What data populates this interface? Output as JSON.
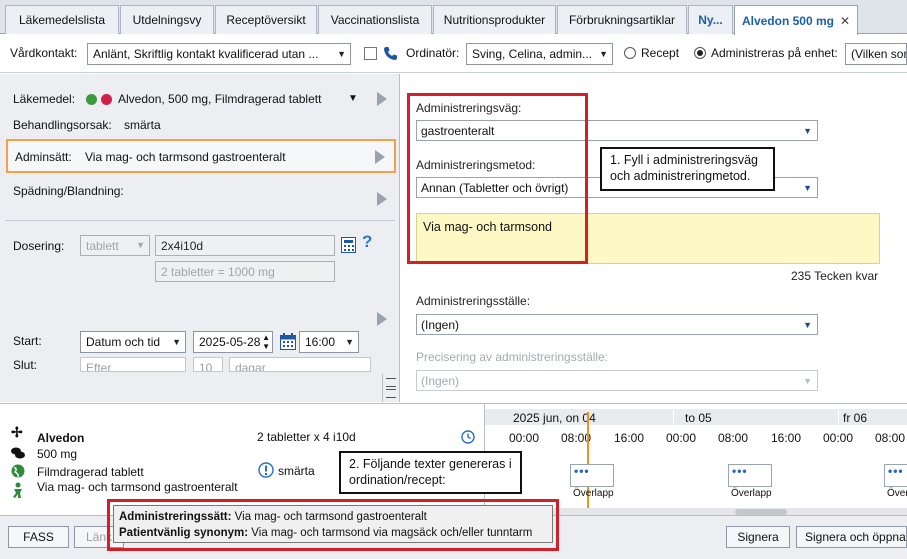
{
  "tabs": [
    {
      "label": "Läkemedelslista"
    },
    {
      "label": "Utdelningsvy"
    },
    {
      "label": "Receptöversikt"
    },
    {
      "label": "Vaccinationslista"
    },
    {
      "label": "Nutritionsprodukter"
    },
    {
      "label": "Förbrukningsartiklar"
    },
    {
      "label": "Ny..."
    },
    {
      "label": "Alvedon 500 mg",
      "close": "✕"
    }
  ],
  "toolbar": {
    "vardkontakt_label": "Vårdkontakt:",
    "vardkontakt_value": "Anlänt, Skriftlig kontakt kvalificerad utan ...",
    "ordinator_label": "Ordinatör:",
    "ordinator_value": "Sving, Celina, admin...",
    "recept_label": "Recept",
    "administreras_label": "Administreras på enhet:",
    "enhet_value": "(Vilken sor"
  },
  "left": {
    "lakemedel_label": "Läkemedel:",
    "lakemedel_value": "Alvedon, 500 mg, Filmdragerad tablett",
    "behandlingsorsak_label": "Behandlingsorsak:",
    "behandlingsorsak_value": "smärta",
    "admin_label": "Adminsätt:",
    "admin_value": "Via mag- och tarmsond gastroenteralt",
    "spadning_label": "Spädning/Blandning:",
    "dosering_label": "Dosering:",
    "dosering_unit": "tablett",
    "dosering_value": "2x4i10d",
    "dosering_calc": "2 tabletter = 1000 mg",
    "help": "?",
    "start_label": "Start:",
    "start_type": "Datum och tid",
    "start_date": "2025-05-28",
    "start_time": "16:00",
    "slut_label": "Slut:",
    "slut_type": "Efter",
    "slut_num": "10",
    "slut_unit": "dagar"
  },
  "right": {
    "vag_label": "Administreringsväg:",
    "vag_value": "gastroenteralt",
    "metod_label": "Administreringsmetod:",
    "metod_value": "Annan (Tabletter och övrigt)",
    "note_text": "Via mag- och tarmsond",
    "teckenkvar": "235 Tecken kvar",
    "stalle_label": "Administreringsställe:",
    "stalle_value": "(Ingen)",
    "precisering_label": "Precisering av administreringsställe:",
    "precisering_value": "(Ingen)"
  },
  "summary": {
    "name": "Alvedon",
    "strength": "500 mg",
    "form": "Filmdragerad tablett",
    "route": "Via mag- och tarmsond gastroenteralt",
    "dose": "2 tabletter x 4 i10d",
    "reason": "smärta"
  },
  "timeline": {
    "dates": [
      "2025 jun, on 04",
      "to 05",
      "fr 06"
    ],
    "times": [
      "00:00",
      "08:00",
      "16:00",
      "00:00",
      "08:00",
      "16:00",
      "00:00",
      "08:00"
    ],
    "overlap_label": "Överlapp",
    "dots": "•••"
  },
  "footer": {
    "fass": "FASS",
    "lank": "Länk",
    "signera": "Signera",
    "signera_oppna": "Signera och öppna"
  },
  "popup": {
    "line1_label": "Administreringssätt:",
    "line1_value": "Via mag- och tarmsond gastroenteralt",
    "line2_label": "Patientvänlig synonym:",
    "line2_value": "Via mag- och tarmsond via magsäck och/eller tunntarm"
  },
  "callouts": {
    "c1": "1. Fyll i administreringsväg och administreringmetod.",
    "c2": "2. Följande texter genereras i ordination/recept:"
  },
  "colors": {
    "annotation_red": "#d31f26",
    "accent_blue": "#1c5fa8",
    "note_yellow": "#fdf8c4"
  },
  "icons": [
    "close-icon",
    "phone-icon",
    "calendar-icon",
    "clock-icon",
    "info-icon",
    "calculator-icon",
    "help-icon",
    "play-icon",
    "splitter-icon",
    "pill-icon",
    "globe-icon",
    "person-icon"
  ]
}
